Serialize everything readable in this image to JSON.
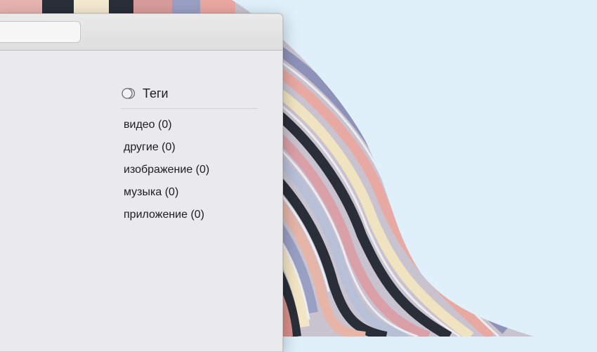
{
  "sidebar": {
    "tags_title": "Теги",
    "tags_icon": "tags-icon",
    "items": [
      {
        "label": "видео (0)"
      },
      {
        "label": "другие (0)"
      },
      {
        "label": "изображение (0)"
      },
      {
        "label": "музыка (0)"
      },
      {
        "label": "приложение (0)"
      }
    ]
  },
  "colors": {
    "window_bg": "#eaeaec",
    "sky": "#dff0fb"
  }
}
